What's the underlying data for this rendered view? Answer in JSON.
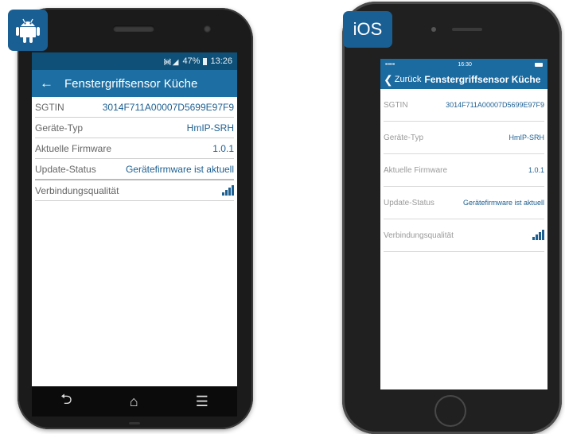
{
  "android": {
    "badge_icon": "android-icon",
    "status_time": "13:26",
    "status_battery": "47%",
    "title": "Fenstergriffsensor Küche",
    "rows": [
      {
        "label": "SGTIN",
        "value": "3014F711A00007D5699E97F9"
      },
      {
        "label": "Geräte-Typ",
        "value": "HmIP-SRH"
      },
      {
        "label": "Aktuelle Firmware",
        "value": "1.0.1"
      },
      {
        "label": "Update-Status",
        "value": "Gerätefirmware ist aktuell"
      },
      {
        "label": "Verbindungsqualität",
        "value": ""
      }
    ],
    "nav": {
      "back_icon": "back-icon",
      "home_icon": "home-icon",
      "menu_icon": "menu-icon"
    }
  },
  "ios": {
    "badge": "iOS",
    "status_time": "16:30",
    "carrier": "•••••",
    "back_label": "Zurück",
    "title": "Fenstergriffsensor Küche",
    "rows": [
      {
        "label": "SGTIN",
        "value": "3014F711A00007D5699E97F9"
      },
      {
        "label": "Geräte-Typ",
        "value": "HmIP-SRH"
      },
      {
        "label": "Aktuelle Firmware",
        "value": "1.0.1"
      },
      {
        "label": "Update-Status",
        "value": "Gerätefirmware ist aktuell"
      },
      {
        "label": "Verbindungsqualität",
        "value": ""
      }
    ]
  },
  "colors": {
    "accent": "#1d6fa3",
    "value_text": "#1d5f91"
  }
}
